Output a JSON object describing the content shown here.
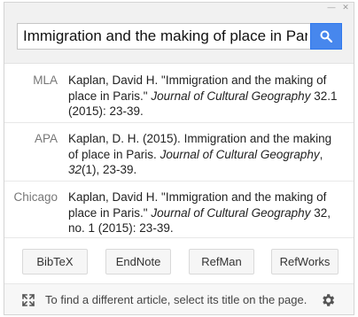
{
  "search": {
    "value": "Immigration and the making of place in Paris"
  },
  "citations": [
    {
      "style": "MLA",
      "text_html": "Kaplan, David H. \"Immigration and the making of place in Paris.\" <i>Journal of Cultural Geography</i> 32.1 (2015): 23-39."
    },
    {
      "style": "APA",
      "text_html": "Kaplan, D. H. (2015). Immigration and the making of place in Paris. <i>Journal of Cultural Geography</i>, <i>32</i>(1), 23-39."
    },
    {
      "style": "Chicago",
      "text_html": "Kaplan, David H. \"Immigration and the making of place in Paris.\" <i>Journal of Cultural Geography</i> 32, no. 1 (2015): 23-39."
    }
  ],
  "export_buttons": [
    "BibTeX",
    "EndNote",
    "RefMan",
    "RefWorks"
  ],
  "footer": {
    "hint": "To find a different article, select its title on the page."
  },
  "colors": {
    "search_button": "#4787ed",
    "header_bg": "#f1f1f1"
  },
  "icons": {
    "search": "magnifier-icon",
    "expand": "expand-arrows-icon",
    "settings": "gear-icon",
    "minimize": "minimize-icon",
    "close": "close-icon"
  }
}
